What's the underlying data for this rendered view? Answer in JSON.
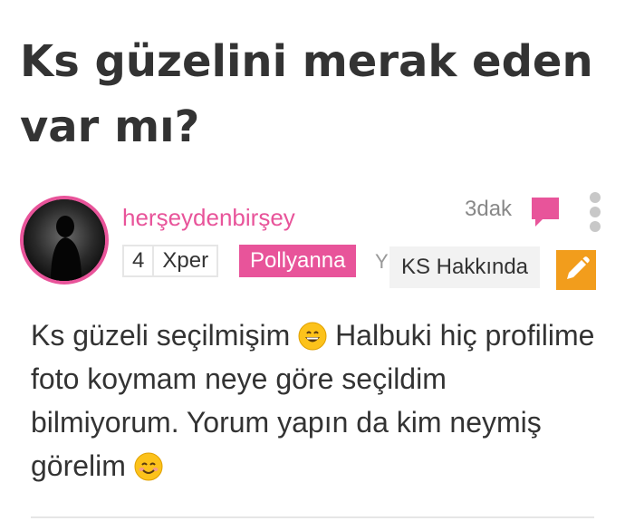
{
  "post": {
    "title": "Ks güzelini merak eden var mı?",
    "author": {
      "username": "herşeydenbirşey",
      "level": "4",
      "level_label": "Xper",
      "badge": "Pollyanna",
      "hidden_char": "Y"
    },
    "time": "3dak",
    "tooltip": "KS Hakkında",
    "body_part1": "Ks güzeli seçilmişim ",
    "body_part2": " Halbuki hiç profilime foto koymam neye göre seçildim bilmiyorum. Yorum yapın da kim neymiş görelim ",
    "icons": {
      "comment": "comment-bubble-icon",
      "more": "more-vertical-icon",
      "edit": "pencil-icon",
      "emoji1": "grinning-face-emoji",
      "emoji2": "smiling-face-emoji"
    },
    "colors": {
      "accent": "#e8549a",
      "edit": "#f29d1c",
      "text": "#333333"
    }
  }
}
